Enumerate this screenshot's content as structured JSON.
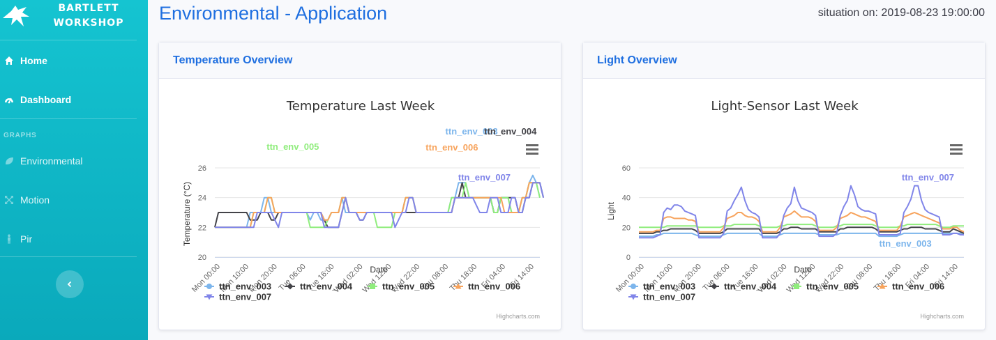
{
  "brand": {
    "line1": "BARTLETT",
    "line2": "WORKSHOP"
  },
  "sidebar": {
    "heading": "GRAPHS",
    "items": [
      {
        "label": "Home",
        "icon": "home-icon"
      },
      {
        "label": "Dashboard",
        "icon": "dashboard-icon"
      },
      {
        "label": "Environmental",
        "icon": "leaf-icon"
      },
      {
        "label": "Motion",
        "icon": "motion-icon"
      },
      {
        "label": "Pir",
        "icon": "person-icon"
      }
    ],
    "toggle_icon": "chevron-left-icon"
  },
  "header": {
    "title": "Environmental - Application",
    "situation": "situation on: 2019-08-23 19:00:00"
  },
  "colors": {
    "sidebar": "#0fb6c6",
    "accent": "#1f6fe0",
    "ttn_env_003": "#7cb5ec",
    "ttn_env_004": "#434348",
    "ttn_env_005": "#90ed7d",
    "ttn_env_006": "#f7a35c",
    "ttn_env_007": "#8085e9"
  },
  "cards": {
    "temperature": {
      "header": "Temperature Overview"
    },
    "light": {
      "header": "Light Overview"
    }
  },
  "credits": "Highcharts.com",
  "chart_data": [
    {
      "type": "line",
      "title": "Temperature Last Week",
      "xlabel": "Date",
      "ylabel": "Temperature (°C)",
      "ylim": [
        20,
        26
      ],
      "yticks": [
        20,
        22,
        24,
        26
      ],
      "x_tick_labels": [
        "Mon 00:00",
        "Mon 10:00",
        "Mon 20:00",
        "Tue 06:00",
        "Tue 16:00",
        "Wed 02:00",
        "Wed 12:00",
        "Wed 22:00",
        "Thu 08:00",
        "Thu 18:00",
        "Fri 04:00",
        "Fri 14:00"
      ],
      "grid": "horizontal",
      "legend": "bottom",
      "series": [
        {
          "name": "ttn_env_003",
          "values": [
            22,
            22,
            22,
            22,
            22,
            22,
            22,
            22,
            22,
            22,
            23,
            23,
            23,
            23,
            24,
            24,
            23,
            23,
            23,
            23,
            23,
            23,
            23,
            23,
            23,
            23,
            23,
            22.5,
            23,
            23,
            22.5,
            22.5,
            22.5,
            23,
            23,
            23,
            24,
            23,
            23,
            23,
            23,
            23,
            23,
            23,
            23,
            23,
            23,
            23,
            23,
            23,
            23,
            23,
            23,
            23,
            24,
            24,
            24,
            23,
            23,
            23,
            23,
            23,
            23,
            23,
            23,
            23,
            23,
            24,
            24,
            25,
            25,
            25,
            24,
            24,
            24,
            24,
            24,
            24,
            24,
            23,
            23,
            24,
            24,
            24,
            23,
            23,
            23,
            24,
            24,
            25,
            25.5,
            25,
            24
          ]
        },
        {
          "name": "ttn_env_004",
          "values": [
            22,
            23,
            23,
            23,
            23,
            23,
            23,
            23,
            23,
            23,
            22.5,
            22.5,
            22.5,
            23,
            23,
            23,
            22.5,
            22.5,
            23,
            23,
            23,
            23,
            23,
            23,
            23,
            23,
            23,
            23,
            23,
            23,
            23,
            22.5,
            22,
            22,
            22,
            22,
            23,
            24,
            23,
            23,
            23,
            22.5,
            22.5,
            23,
            23,
            23,
            23,
            23,
            23,
            23,
            23,
            23,
            23,
            23,
            23,
            23,
            23,
            23,
            23,
            23,
            23,
            23,
            23,
            23,
            23,
            23,
            23,
            23,
            24,
            24,
            25,
            24,
            24,
            24,
            24,
            24,
            24,
            24,
            24,
            23,
            23,
            24,
            24,
            24,
            24,
            24,
            23,
            23,
            24,
            24,
            25,
            25,
            25,
            24
          ]
        },
        {
          "name": "ttn_env_005",
          "values": [
            22,
            22,
            22,
            22,
            22,
            22,
            22,
            22,
            22,
            22,
            22,
            23,
            23,
            23,
            23,
            24,
            24,
            23,
            23,
            23,
            23,
            23,
            23,
            23,
            23,
            23,
            23,
            22,
            22,
            22,
            22,
            22,
            22.5,
            23,
            23,
            23,
            24,
            24,
            23,
            23,
            23,
            23,
            23,
            23,
            23,
            23,
            22,
            22,
            22,
            22,
            22,
            23,
            23,
            23,
            24,
            24,
            24,
            23,
            23,
            23,
            23,
            23,
            23,
            23,
            23,
            23,
            23,
            24,
            24,
            24,
            24,
            25,
            24,
            24,
            24,
            24,
            24,
            24,
            24,
            23,
            23,
            24,
            24,
            24,
            23,
            23,
            23,
            24,
            24,
            25,
            25,
            25,
            24
          ]
        },
        {
          "name": "ttn_env_006",
          "values": [
            22,
            22,
            22,
            22,
            22,
            22,
            22,
            22,
            22,
            22,
            22,
            23,
            23,
            23,
            23,
            24,
            24,
            23,
            23,
            23,
            23,
            23,
            23,
            23,
            23,
            23,
            23,
            23,
            23,
            23,
            23,
            22.5,
            22.5,
            23,
            23,
            23,
            24,
            24,
            23,
            23,
            23,
            23,
            23,
            23,
            23,
            23,
            23,
            23,
            23,
            23,
            23,
            23,
            23,
            23,
            24,
            24,
            24,
            23,
            23,
            23,
            23,
            23,
            23,
            23,
            23,
            23,
            23,
            23,
            24,
            24,
            24,
            24,
            24,
            24,
            24,
            24,
            24,
            24,
            24,
            24,
            24,
            24,
            23,
            23,
            23,
            23,
            23,
            24,
            24,
            25,
            25,
            25,
            25
          ]
        },
        {
          "name": "ttn_env_007",
          "values": [
            22,
            22,
            22,
            22,
            22,
            22,
            22,
            22,
            22,
            22,
            22,
            22,
            23,
            23,
            23,
            23,
            23,
            22.5,
            22,
            23,
            23,
            23,
            23,
            23,
            23,
            23,
            23,
            23,
            23,
            23,
            23,
            22,
            22,
            22,
            22,
            22,
            23,
            24,
            23,
            23,
            23,
            22.5,
            22.5,
            23,
            23,
            23,
            23,
            23,
            23,
            23,
            23,
            22,
            22.5,
            23,
            23,
            24,
            24,
            23,
            23,
            23,
            23,
            23,
            23,
            23,
            23,
            23,
            23,
            23,
            24,
            24,
            24,
            24,
            24,
            24,
            23.5,
            23,
            23,
            23,
            24,
            24,
            24,
            23,
            23,
            23,
            24,
            24,
            23,
            23,
            24,
            24,
            25,
            25,
            25,
            24
          ]
        }
      ],
      "data_labels": [
        "ttn_env_003",
        "ttn_env_004",
        "ttn_env_005",
        "ttn_env_006",
        "ttn_env_007"
      ]
    },
    {
      "type": "line",
      "title": "Light-Sensor Last Week",
      "xlabel": "Date",
      "ylabel": "Light",
      "ylim": [
        0,
        60
      ],
      "yticks": [
        0,
        20,
        40,
        60
      ],
      "x_tick_labels": [
        "Mon 00:00",
        "Mon 10:00",
        "Mon 20:00",
        "Tue 06:00",
        "Tue 16:00",
        "Wed 02:00",
        "Wed 12:00",
        "Wed 22:00",
        "Thu 08:00",
        "Thu 18:00",
        "Fri 04:00",
        "Fri 14:00"
      ],
      "grid": "horizontal",
      "legend": "bottom",
      "series": [
        {
          "name": "ttn_env_003",
          "values": [
            14,
            14,
            14,
            14,
            14,
            15,
            15,
            16,
            16,
            16,
            16,
            16,
            16,
            16,
            16,
            16,
            15,
            14,
            14,
            14,
            14,
            14,
            14,
            14,
            15,
            16,
            16,
            16,
            16,
            16,
            16,
            16,
            16,
            16,
            16,
            14,
            14,
            14,
            14,
            14,
            15,
            16,
            16,
            16,
            16,
            16,
            16,
            16,
            16,
            16,
            16,
            15,
            15,
            15,
            15,
            15,
            15,
            16,
            16,
            16,
            16,
            16,
            16,
            16,
            16,
            16,
            16,
            16,
            14,
            14,
            14,
            14,
            14,
            14,
            15,
            16,
            16,
            16,
            16,
            16,
            16,
            16,
            16,
            16,
            16,
            16,
            16,
            16,
            16,
            16,
            16,
            16,
            16
          ]
        },
        {
          "name": "ttn_env_004",
          "values": [
            16,
            16,
            16,
            16,
            16,
            17,
            17,
            18,
            18,
            19,
            19,
            19,
            19,
            19,
            19,
            19,
            18,
            16,
            16,
            16,
            16,
            16,
            16,
            16,
            17,
            19,
            19,
            19,
            19,
            19,
            19,
            19,
            19,
            19,
            19,
            16,
            16,
            16,
            16,
            16,
            17,
            19,
            19,
            20,
            20,
            20,
            19,
            19,
            19,
            19,
            19,
            17,
            17,
            17,
            17,
            17,
            17,
            19,
            19,
            20,
            20,
            20,
            20,
            20,
            20,
            20,
            20,
            19,
            17,
            17,
            17,
            17,
            17,
            17,
            18,
            19,
            19,
            20,
            20,
            20,
            20,
            19,
            19,
            19,
            19,
            18,
            17,
            17,
            17,
            19,
            18,
            17,
            16
          ]
        },
        {
          "name": "ttn_env_005",
          "values": [
            20,
            20,
            20,
            20,
            20,
            20,
            20,
            20,
            21,
            21,
            21,
            21,
            21,
            21,
            21,
            21,
            21,
            20,
            20,
            20,
            20,
            20,
            20,
            20,
            21,
            21,
            21,
            22,
            22,
            22,
            22,
            22,
            22,
            22,
            21,
            20,
            20,
            20,
            20,
            20,
            21,
            21,
            22,
            22,
            22,
            22,
            22,
            22,
            22,
            22,
            21,
            20,
            20,
            20,
            20,
            20,
            21,
            21,
            22,
            22,
            22,
            22,
            22,
            22,
            22,
            22,
            22,
            21,
            20,
            20,
            20,
            20,
            20,
            20,
            21,
            21,
            22,
            22,
            22,
            22,
            22,
            22,
            22,
            22,
            22,
            21,
            20,
            20,
            20,
            21,
            21,
            21,
            21
          ]
        },
        {
          "name": "ttn_env_006",
          "values": [
            17,
            17,
            17,
            17,
            17,
            18,
            18,
            26,
            27,
            27,
            26,
            26,
            26,
            26,
            25,
            25,
            24,
            17,
            17,
            17,
            17,
            17,
            17,
            17,
            20,
            26,
            27,
            28,
            30,
            30,
            28,
            27,
            27,
            26,
            24,
            17,
            17,
            17,
            17,
            17,
            20,
            27,
            28,
            29,
            31,
            29,
            27,
            27,
            27,
            26,
            24,
            18,
            18,
            18,
            18,
            18,
            20,
            26,
            27,
            28,
            30,
            29,
            28,
            27,
            27,
            26,
            25,
            24,
            18,
            18,
            18,
            18,
            18,
            18,
            21,
            27,
            28,
            29,
            30,
            29,
            28,
            27,
            26,
            25,
            24,
            23,
            19,
            19,
            19,
            20,
            20,
            18,
            17
          ]
        },
        {
          "name": "ttn_env_007",
          "values": [
            13,
            13,
            13,
            13,
            13,
            14,
            15,
            30,
            33,
            32,
            35,
            35,
            34,
            31,
            30,
            29,
            28,
            13,
            13,
            13,
            13,
            13,
            13,
            13,
            16,
            31,
            33,
            38,
            42,
            47,
            38,
            32,
            30,
            29,
            27,
            13,
            13,
            13,
            13,
            13,
            16,
            28,
            33,
            36,
            47,
            38,
            33,
            32,
            31,
            30,
            28,
            14,
            14,
            14,
            14,
            14,
            16,
            28,
            34,
            38,
            48,
            42,
            34,
            32,
            31,
            31,
            30,
            29,
            15,
            15,
            15,
            15,
            15,
            15,
            16,
            30,
            34,
            39,
            48,
            48,
            38,
            32,
            30,
            29,
            28,
            27,
            15,
            15,
            15,
            16,
            16,
            15,
            15
          ]
        }
      ],
      "data_labels": [
        "ttn_env_007",
        "ttn_env_003"
      ]
    }
  ]
}
